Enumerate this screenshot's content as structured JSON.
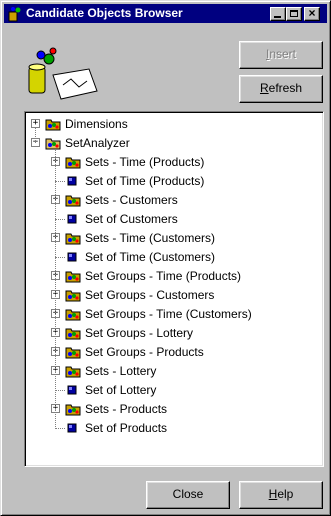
{
  "window": {
    "title": "Candidate Objects Browser",
    "close_glyph": "×"
  },
  "buttons": {
    "insert": "Insert",
    "refresh": "Refresh",
    "close": "Close",
    "help": "Help"
  },
  "tree": {
    "roots": [
      {
        "label": "Dimensions",
        "icon": "folder-icon",
        "expander": "+",
        "expanded": false
      },
      {
        "label": "SetAnalyzer",
        "icon": "folder-open-icon",
        "expander": "−",
        "expanded": true
      }
    ],
    "children": [
      {
        "label": "Sets - Time (Products)",
        "icon": "folder-icon",
        "expander": "+"
      },
      {
        "label": "Set of Time (Products)",
        "icon": "set-icon",
        "expander": ""
      },
      {
        "label": "Sets - Customers",
        "icon": "folder-icon",
        "expander": "+"
      },
      {
        "label": "Set of Customers",
        "icon": "set-icon",
        "expander": ""
      },
      {
        "label": "Sets - Time (Customers)",
        "icon": "folder-icon",
        "expander": "+"
      },
      {
        "label": "Set of Time (Customers)",
        "icon": "set-icon",
        "expander": ""
      },
      {
        "label": "Set Groups - Time (Products)",
        "icon": "folder-icon",
        "expander": "+"
      },
      {
        "label": "Set Groups - Customers",
        "icon": "folder-icon",
        "expander": "+"
      },
      {
        "label": "Set Groups - Time (Customers)",
        "icon": "folder-icon",
        "expander": "+"
      },
      {
        "label": "Set Groups - Lottery",
        "icon": "folder-icon",
        "expander": "+"
      },
      {
        "label": "Set Groups - Products",
        "icon": "folder-icon",
        "expander": "+"
      },
      {
        "label": "Sets - Lottery",
        "icon": "folder-icon",
        "expander": "+"
      },
      {
        "label": "Set of Lottery",
        "icon": "set-icon",
        "expander": ""
      },
      {
        "label": "Sets - Products",
        "icon": "folder-icon",
        "expander": "+"
      },
      {
        "label": "Set of Products",
        "icon": "set-icon",
        "expander": ""
      }
    ]
  },
  "colors": {
    "titlebar": "#000080",
    "face": "#c0c0c0",
    "disabled_text": "#808080"
  }
}
